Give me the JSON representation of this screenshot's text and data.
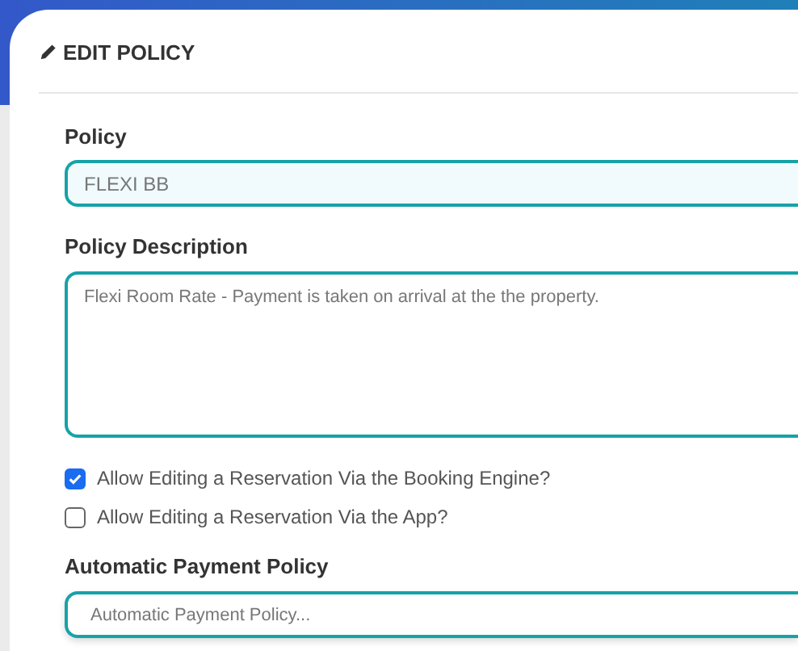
{
  "header": {
    "title": "EDIT POLICY"
  },
  "policy": {
    "label": "Policy",
    "value": "FLEXI BB"
  },
  "description": {
    "label": "Policy Description",
    "value": "Flexi Room Rate - Payment is taken on arrival at the the property."
  },
  "options": [
    {
      "label": "Allow Editing a Reservation Via the Booking Engine?",
      "checked": true
    },
    {
      "label": "Allow Editing a Reservation Via the App?",
      "checked": false
    }
  ],
  "payment_policy": {
    "label": "Automatic Payment Policy",
    "placeholder": "Automatic Payment Policy..."
  }
}
